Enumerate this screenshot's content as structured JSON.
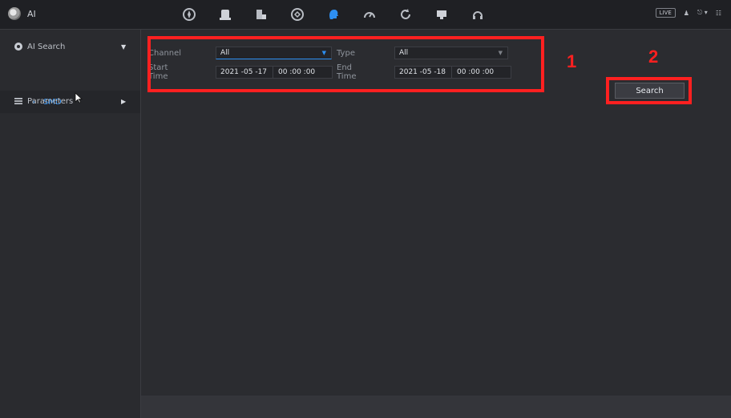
{
  "app": {
    "title": "AI",
    "live_label": "LIVE"
  },
  "sidebar": {
    "items": [
      {
        "label": "AI Search",
        "expanded": true
      },
      {
        "label": "SMD",
        "active": true
      },
      {
        "label": "Parameters",
        "expanded": false
      }
    ]
  },
  "form": {
    "channel_label": "Channel",
    "channel_value": "All",
    "type_label": "Type",
    "type_value": "All",
    "start_label": "Start Time",
    "start_date": "2021 -05 -17",
    "start_time": "00 :00 :00",
    "end_label": "End Time",
    "end_date": "2021 -05 -18",
    "end_time": "00 :00 :00"
  },
  "actions": {
    "search_label": "Search"
  },
  "annotations": {
    "marker_1": "1",
    "marker_2": "2"
  },
  "colors": {
    "accent": "#2d8ff2",
    "highlight": "#ff2020",
    "bg": "#2b2c30"
  },
  "top_icons": [
    "compass-icon",
    "storage-icon",
    "server-icon",
    "network-icon",
    "ai-head-icon",
    "gauge-icon",
    "refresh-icon",
    "monitor-icon",
    "headset-icon"
  ]
}
